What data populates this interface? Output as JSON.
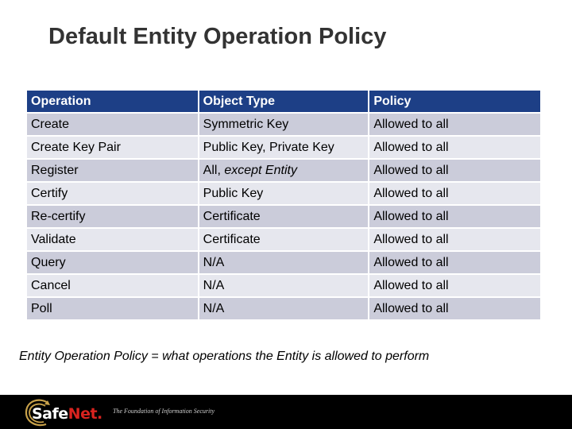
{
  "slide": {
    "title": "Default Entity Operation Policy",
    "caption": "Entity Operation Policy = what operations the Entity is allowed to perform"
  },
  "table": {
    "headers": [
      "Operation",
      "Object Type",
      "Policy"
    ],
    "rows": [
      {
        "operation": "Create",
        "object_type": "Symmetric Key",
        "policy": "Allowed to all"
      },
      {
        "operation": "Create Key Pair",
        "object_type": "Public Key, Private Key",
        "policy": "Allowed to all"
      },
      {
        "operation": "Register",
        "object_type_prefix": "All, ",
        "object_type_italic": "except Entity",
        "policy": "Allowed to all"
      },
      {
        "operation": "Certify",
        "object_type": "Public Key",
        "policy": "Allowed to all"
      },
      {
        "operation": "Re-certify",
        "object_type": "Certificate",
        "policy": "Allowed to all"
      },
      {
        "operation": "Validate",
        "object_type": "Certificate",
        "policy": "Allowed to all"
      },
      {
        "operation": "Query",
        "object_type": "N/A",
        "policy": "Allowed to all"
      },
      {
        "operation": "Cancel",
        "object_type": "N/A",
        "policy": "Allowed to all"
      },
      {
        "operation": "Poll",
        "object_type": "N/A",
        "policy": "Allowed to all"
      }
    ]
  },
  "footer": {
    "logo_part1": "Safe",
    "logo_part2": "Net",
    "logo_dot": ".",
    "tagline": "The Foundation of Information Security",
    "logo_icon": "swirl-logo-icon"
  },
  "colors": {
    "header_bg": "#1d3f86",
    "row_dark": "#cbccda",
    "row_light": "#e6e7ee",
    "brand_red": "#d8231f",
    "swirl_gold": "#c9a24a"
  }
}
